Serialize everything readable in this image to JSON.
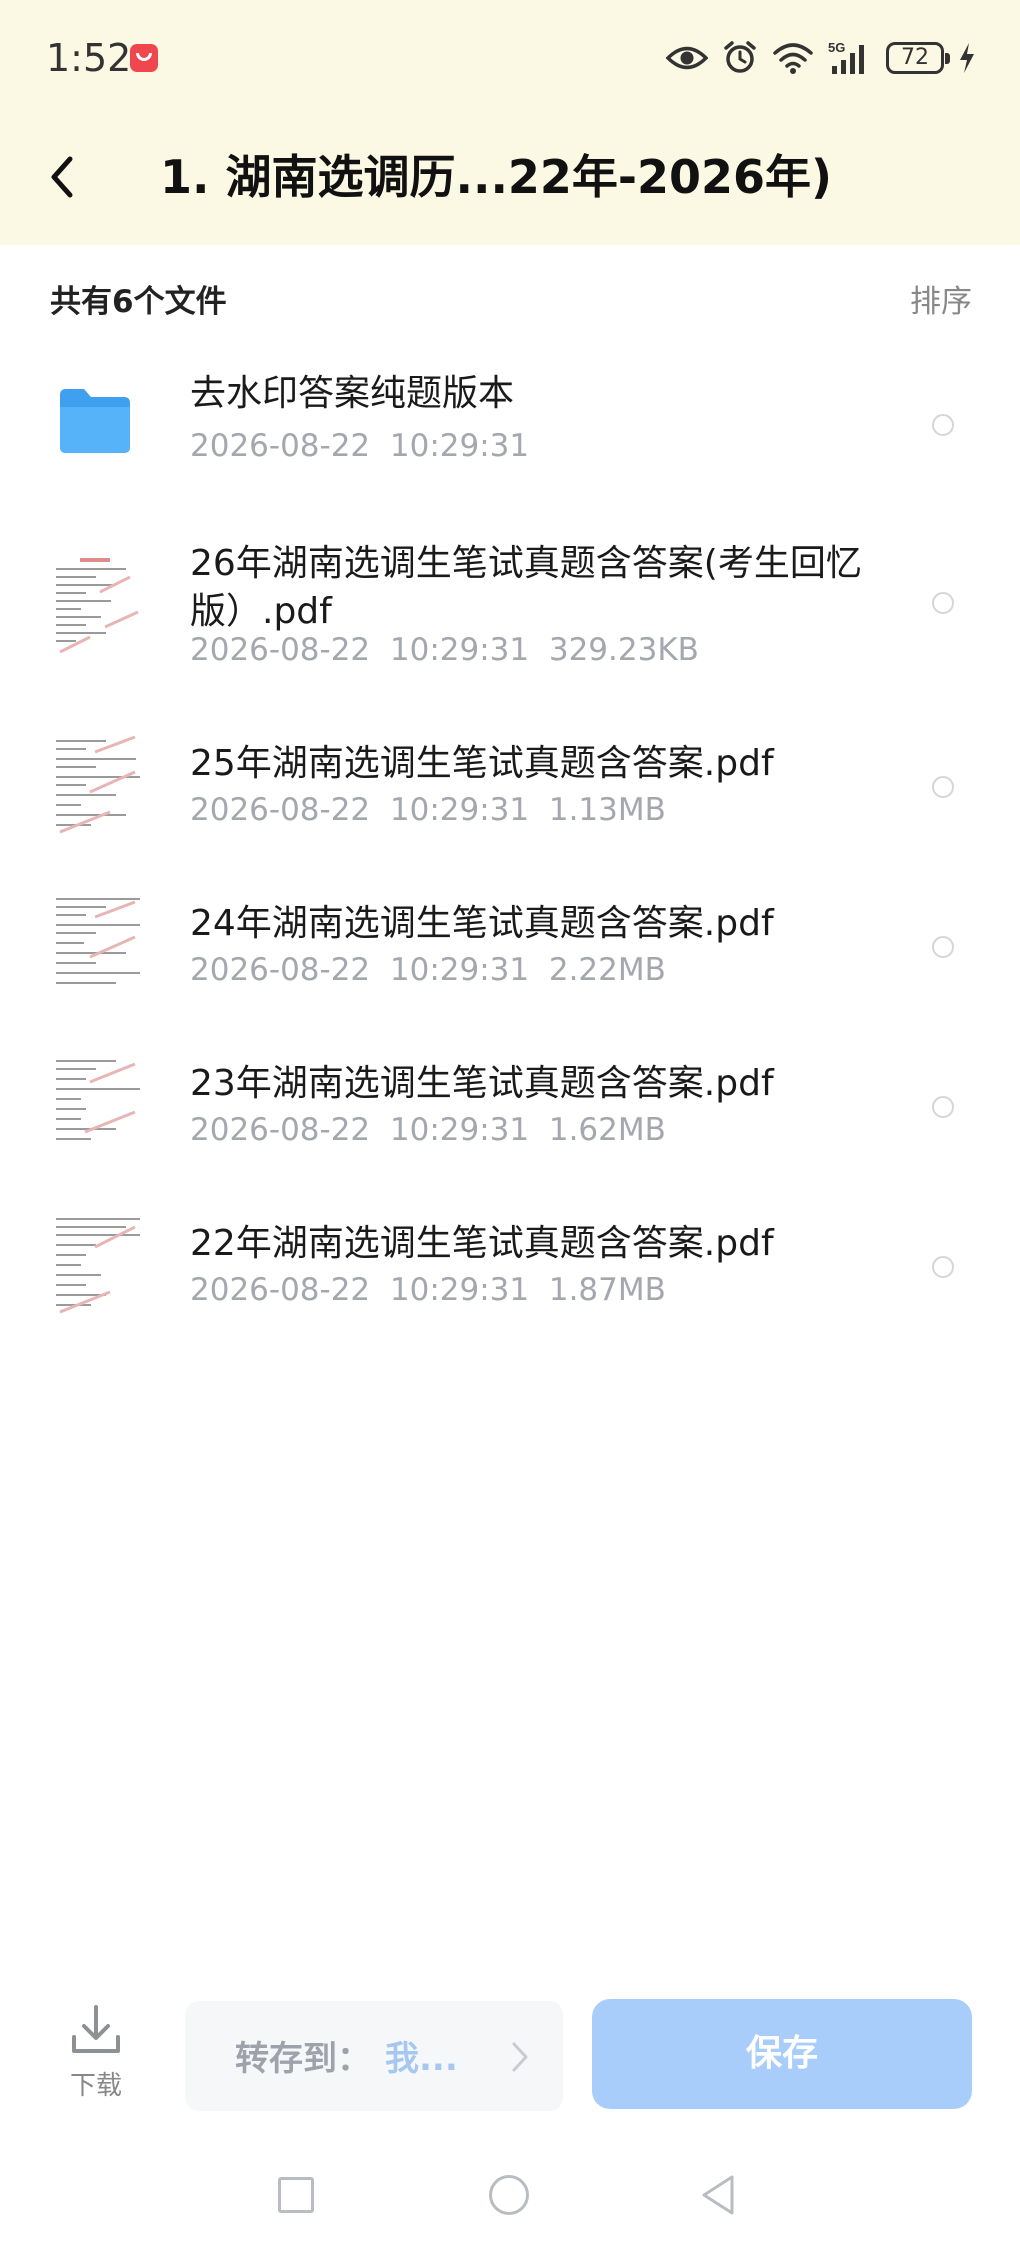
{
  "status_bar": {
    "time": "1:52",
    "battery": "72",
    "network": "5G",
    "icons": [
      "eye-icon",
      "alarm-icon",
      "wifi-icon",
      "signal-icon",
      "battery-icon",
      "charging-icon"
    ]
  },
  "header": {
    "title": "1. 湖南选调历...22年-2026年)"
  },
  "list": {
    "count_label": "共有6个文件",
    "sort_label": "排序",
    "items": [
      {
        "name": "去水印答案纯题版本",
        "date": "2026-08-22",
        "time": "10:29:31",
        "size": "",
        "type": "folder"
      },
      {
        "name": "26年湖南选调生笔试真题含答案(考生回忆版）.pdf",
        "date": "2026-08-22",
        "time": "10:29:31",
        "size": "329.23KB",
        "type": "pdf"
      },
      {
        "name": "25年湖南选调生笔试真题含答案.pdf",
        "date": "2026-08-22",
        "time": "10:29:31",
        "size": "1.13MB",
        "type": "pdf"
      },
      {
        "name": "24年湖南选调生笔试真题含答案.pdf",
        "date": "2026-08-22",
        "time": "10:29:31",
        "size": "2.22MB",
        "type": "pdf"
      },
      {
        "name": "23年湖南选调生笔试真题含答案.pdf",
        "date": "2026-08-22",
        "time": "10:29:31",
        "size": "1.62MB",
        "type": "pdf"
      },
      {
        "name": "22年湖南选调生笔试真题含答案.pdf",
        "date": "2026-08-22",
        "time": "10:29:31",
        "size": "1.87MB",
        "type": "pdf"
      }
    ]
  },
  "bottom": {
    "download_label": "下载",
    "transfer_label": "转存到：",
    "transfer_target": "我...",
    "save_label": "保存"
  },
  "colors": {
    "topbar_bg": "#fbf8e4",
    "save_button": "#a9cdfa",
    "folder": "#3fa0f0",
    "meta_text": "#a4a7ad"
  }
}
